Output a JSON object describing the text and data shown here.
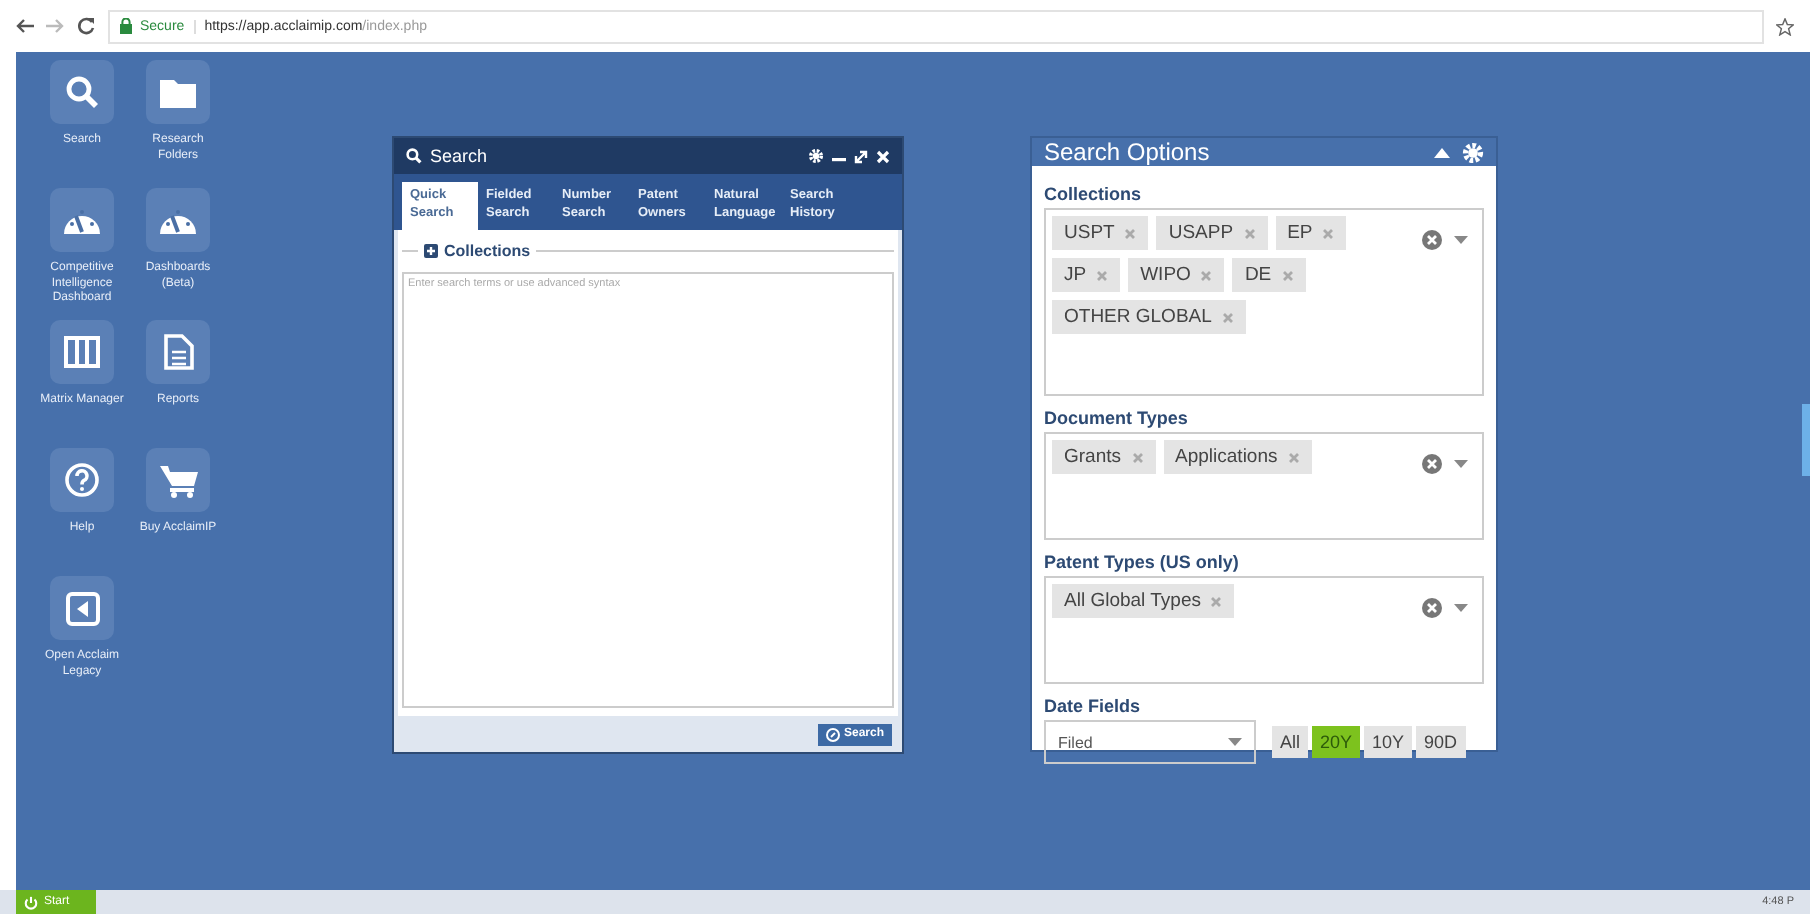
{
  "browser": {
    "secure": "Secure",
    "url_host": "https://app.acclaimip.com",
    "url_path": "/index.php"
  },
  "sidebar": {
    "items": [
      {
        "label": "Search"
      },
      {
        "label": "Research Folders"
      },
      {
        "label": "Competitive Intelligence Dashboard"
      },
      {
        "label": "Dashboards (Beta)"
      },
      {
        "label": "Matrix Manager"
      },
      {
        "label": "Reports"
      },
      {
        "label": "Help"
      },
      {
        "label": "Buy AcclaimIP"
      },
      {
        "label": "Open Acclaim Legacy"
      }
    ]
  },
  "search_window": {
    "title": "Search",
    "tabs": [
      {
        "label": "Quick Search",
        "selected": true
      },
      {
        "label": "Fielded Search",
        "selected": false
      },
      {
        "label": "Number Search",
        "selected": false
      },
      {
        "label": "Patent Owners",
        "selected": false
      },
      {
        "label": "Natural Language",
        "selected": false
      },
      {
        "label": "Search History",
        "selected": false
      }
    ],
    "collections_label": "Collections",
    "placeholder": "Enter search terms or use advanced syntax",
    "search_button": "Search"
  },
  "search_options": {
    "title": "Search Options",
    "sections": [
      {
        "label": "Collections",
        "tags": [
          "USPT",
          "USAPP",
          "EP",
          "JP",
          "WIPO",
          "DE",
          "OTHER GLOBAL"
        ]
      },
      {
        "label": "Document Types",
        "tags": [
          "Grants",
          "Applications"
        ]
      },
      {
        "label": "Patent Types (US only)",
        "tags": [
          "All Global Types"
        ]
      }
    ],
    "date_fields": {
      "label": "Date Fields",
      "value": "Filed",
      "ranges": [
        {
          "label": "All",
          "selected": false
        },
        {
          "label": "20Y",
          "selected": true
        },
        {
          "label": "10Y",
          "selected": false
        },
        {
          "label": "90D",
          "selected": false
        }
      ]
    }
  },
  "taskbar": {
    "start": "Start",
    "clock": "4:48 P"
  }
}
